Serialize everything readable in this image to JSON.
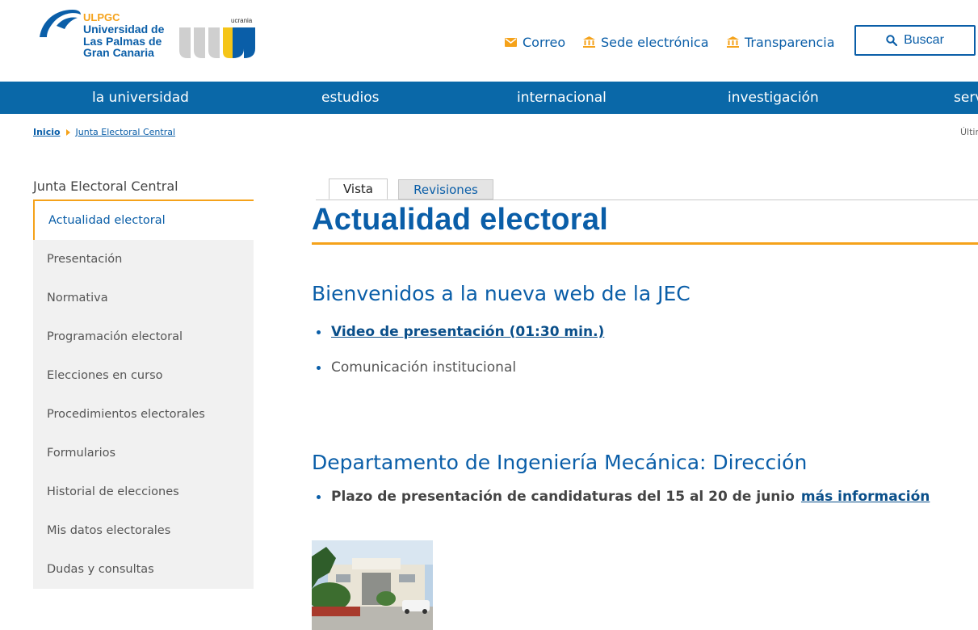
{
  "logo": {
    "acronym": "ULPGC",
    "line1": "Universidad de",
    "line2": "Las Palmas de",
    "line3": "Gran Canaria",
    "badge_text": "ucrania"
  },
  "utility": {
    "mail": "Correo",
    "sede": "Sede electrónica",
    "transparencia": "Transparencia",
    "search": "Buscar"
  },
  "nav": [
    "la universidad",
    "estudios",
    "internacional",
    "investigación",
    "serv"
  ],
  "breadcrumb": {
    "home": "Inicio",
    "current": "Junta Electoral Central",
    "right": "Últim"
  },
  "sidebar": {
    "title": "Junta Electoral Central",
    "items": [
      "Actualidad electoral",
      "Presentación",
      "Normativa",
      "Programación electoral",
      "Elecciones en curso",
      "Procedimientos electorales",
      "Formularios",
      "Historial de elecciones",
      "Mis datos electorales",
      "Dudas y consultas"
    ]
  },
  "tabs": {
    "vista": "Vista",
    "revisiones": "Revisiones"
  },
  "main": {
    "title": "Actualidad electoral",
    "section1": {
      "heading": "Bienvenidos a la nueva web de la JEC",
      "video_link": "Video de presentación (01:30 min.)",
      "comunicacion": "Comunicación institucional"
    },
    "section2": {
      "heading": "Departamento de Ingeniería Mecánica: Dirección",
      "text": "Plazo de presentación de candidaturas del 15 al 20 de junio",
      "more_link": "más información"
    }
  },
  "colors": {
    "brand_blue": "#0a5ea8",
    "nav_blue": "#0a68a8",
    "accent_orange": "#f5a21a"
  }
}
